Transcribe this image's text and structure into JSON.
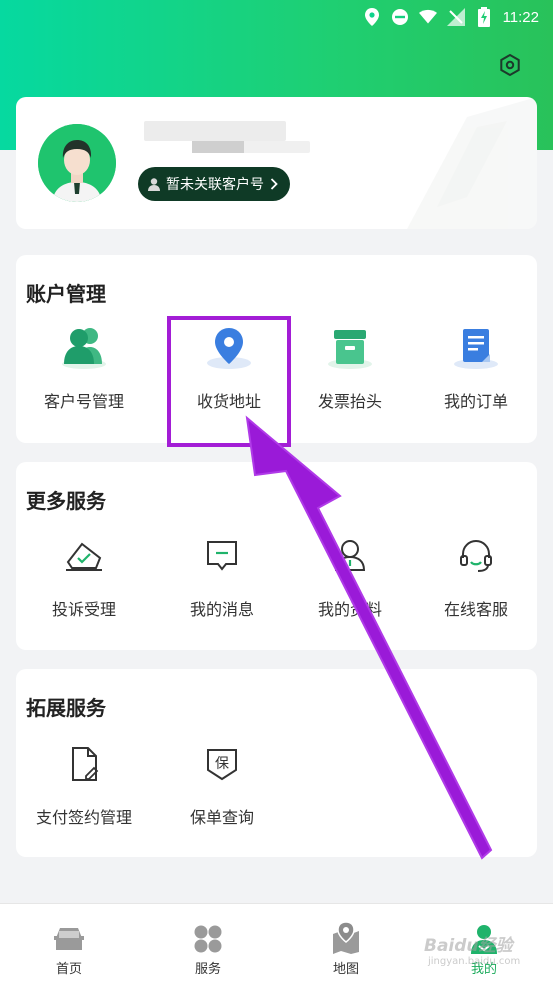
{
  "status_bar": {
    "time": "11:22"
  },
  "profile": {
    "link_badge_label": "暂未关联客户号"
  },
  "account": {
    "title": "账户管理",
    "items": [
      {
        "label": "客户号管理",
        "icon": "users-icon"
      },
      {
        "label": "收货地址",
        "icon": "location-pin-icon"
      },
      {
        "label": "发票抬头",
        "icon": "invoice-box-icon"
      },
      {
        "label": "我的订单",
        "icon": "order-doc-icon"
      }
    ]
  },
  "more_services": {
    "title": "更多服务",
    "items": [
      {
        "label": "投诉受理",
        "icon": "complaint-icon"
      },
      {
        "label": "我的消息",
        "icon": "message-icon"
      },
      {
        "label": "我的资料",
        "icon": "profile-icon"
      },
      {
        "label": "在线客服",
        "icon": "headset-icon"
      }
    ]
  },
  "ext_services": {
    "title": "拓展服务",
    "items": [
      {
        "label": "支付签约管理",
        "icon": "sign-doc-icon"
      },
      {
        "label": "保单查询",
        "icon": "policy-shield-icon"
      }
    ]
  },
  "tabbar": {
    "items": [
      {
        "label": "首页",
        "icon": "car-icon"
      },
      {
        "label": "服务",
        "icon": "grid-icon"
      },
      {
        "label": "地图",
        "icon": "map-icon"
      },
      {
        "label": "我的",
        "icon": "user-active-icon"
      }
    ],
    "active_index": 3
  },
  "watermark": {
    "text": "Baidu经验",
    "sub": "jingyan.baidu.com"
  },
  "colors": {
    "accent": "#1fc46e",
    "header_start": "#06d9a0",
    "header_end": "#29c25a",
    "annotation": "#a31dd6",
    "badge_bg": "#0f3a26"
  }
}
